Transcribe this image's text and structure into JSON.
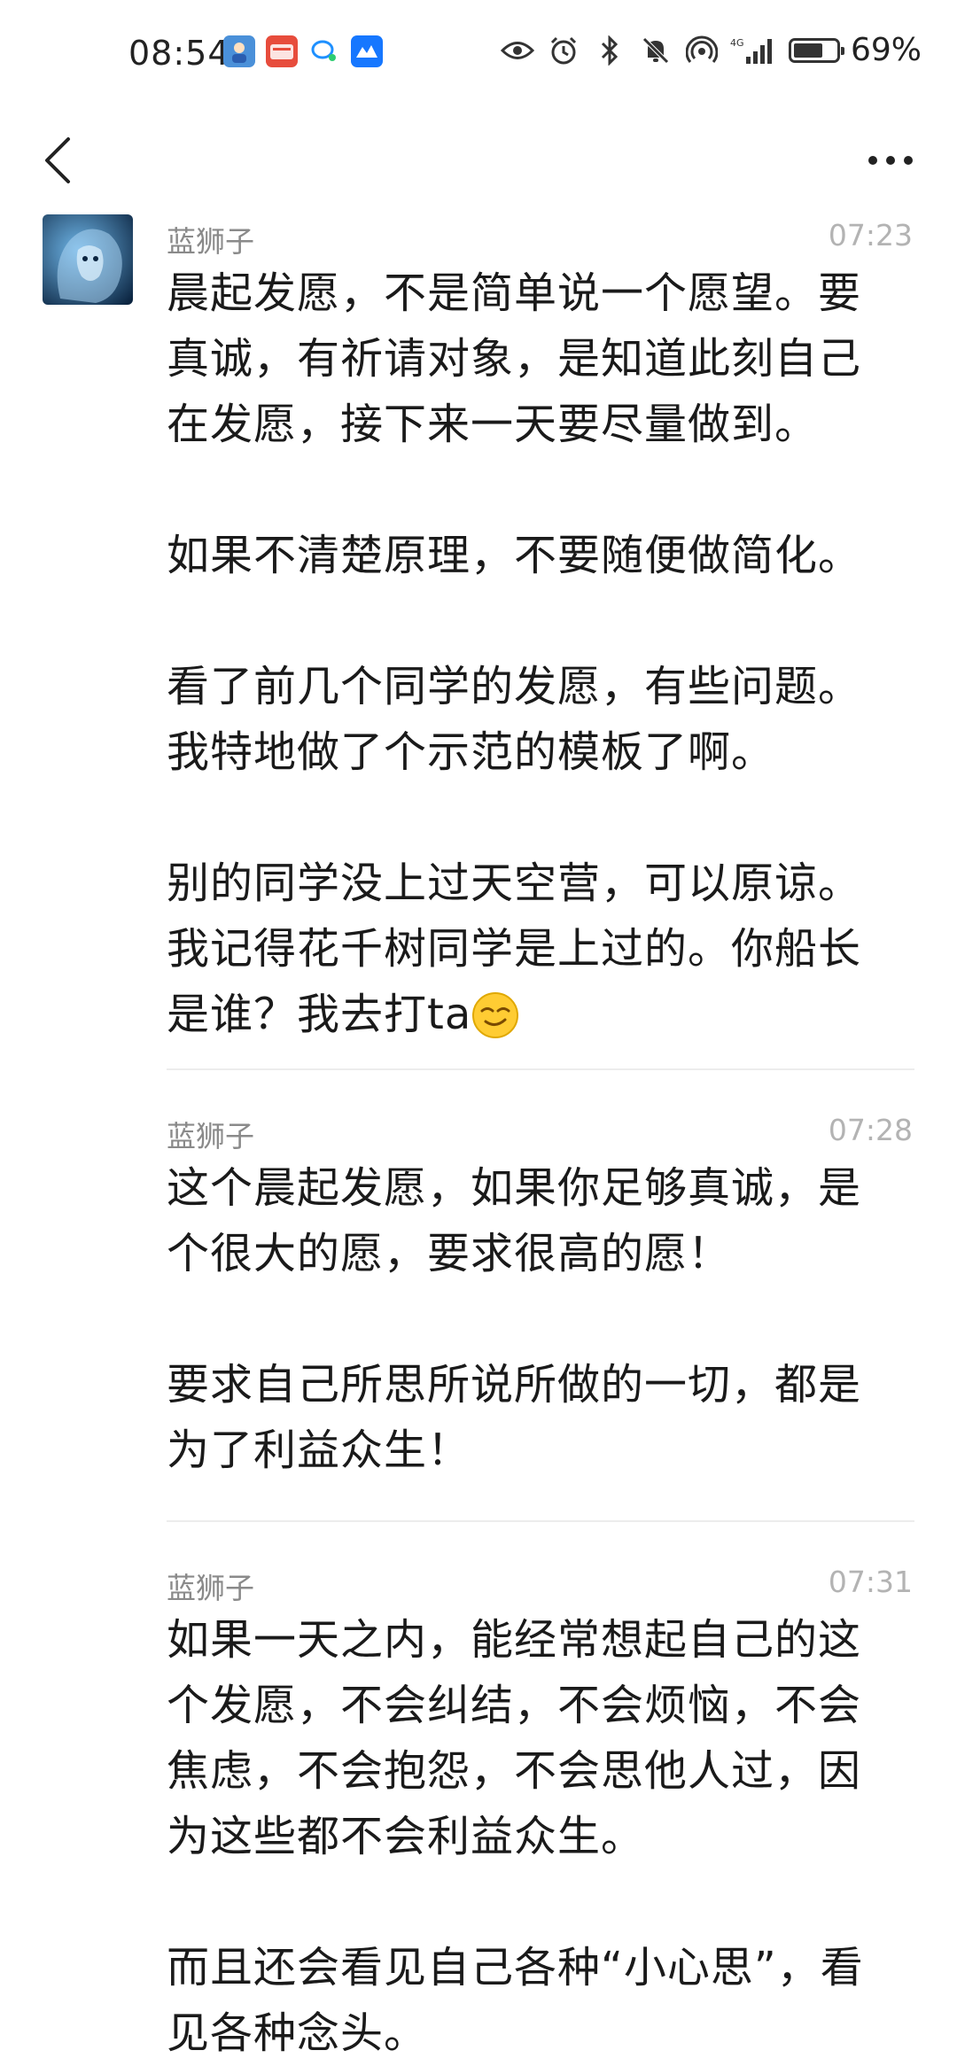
{
  "status_bar": {
    "time": "08:54",
    "battery_percent": "69%",
    "battery_level": 0.69,
    "signal_label": "4G",
    "notification_icons": [
      "app-avatar-icon",
      "red-app-icon",
      "chat-bubble-icon",
      "blue-app-icon"
    ],
    "system_icons": [
      "eye-icon",
      "alarm-icon",
      "bluetooth-icon",
      "mute-bell-icon",
      "hotspot-icon",
      "signal-icon"
    ]
  },
  "navbar": {
    "back_icon": "chevron-left-icon",
    "more_icon": "ellipsis-icon"
  },
  "messages": [
    {
      "sender": "蓝狮子",
      "time": "07:23",
      "paragraphs": [
        "晨起发愿，不是简单说一个愿望。要\n真诚，有祈请对象，是知道此刻自己\n在发愿，接下来一天要尽量做到。",
        "如果不清楚原理，不要随便做简化。",
        "看了前几个同学的发愿，有些问题。\n我特地做了个示范的模板了啊。",
        "别的同学没上过天空营，可以原谅。\n我记得花千树同学是上过的。你船长\n是谁？我去打ta"
      ],
      "emoji": "smirk-emoji"
    },
    {
      "sender": "蓝狮子",
      "time": "07:28",
      "paragraphs": [
        "这个晨起发愿，如果你足够真诚，是\n个很大的愿，要求很高的愿！",
        "要求自己所思所说所做的一切，都是\n为了利益众生！"
      ]
    },
    {
      "sender": "蓝狮子",
      "time": "07:31",
      "paragraphs": [
        "如果一天之内，能经常想起自己的这\n个发愿，不会纠结，不会烦恼，不会\n焦虑，不会抱怨，不会思他人过，因\n为这些都不会利益众生。",
        "而且还会看见自己各种“小心思”，看\n见各种念头。"
      ]
    }
  ],
  "colors": {
    "background": "#ffffff",
    "text": "#1a1a1a",
    "meta": "#8a8a8a",
    "time": "#b3b3b3",
    "divider": "#ececec"
  }
}
